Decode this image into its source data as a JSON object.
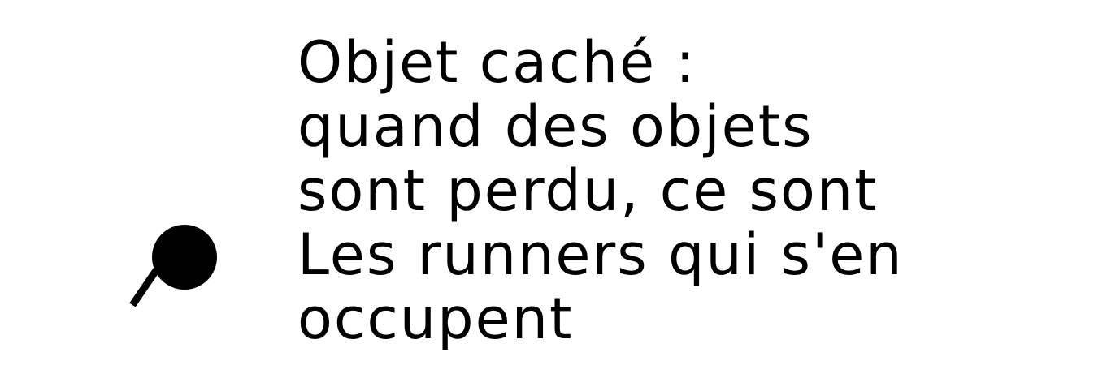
{
  "icon": "magnifier-icon",
  "text_color": "#000000",
  "lines": [
    "Objet caché :",
    "quand des objets",
    "sont perdu, ce sont",
    "Les runners qui s'en",
    "occupent"
  ]
}
